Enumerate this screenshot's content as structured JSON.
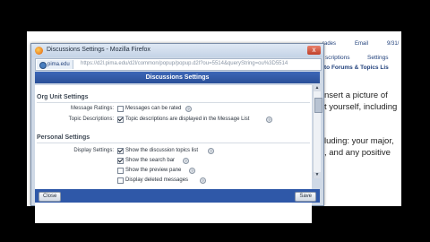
{
  "background_page": {
    "toolbar": {
      "grades": "rades",
      "email": "Email",
      "date": "9/31/"
    },
    "subnav": {
      "descriptions": "scriptions",
      "settings": "Settings"
    },
    "breadcrumb": "to Forums & Topics Lis",
    "lines": [
      "nsert a picture of",
      "t yourself, including",
      "luding: your major,",
      ", and any positive"
    ]
  },
  "window": {
    "title": "Discussions Settings - Mozilla Firefox",
    "close_glyph": "x",
    "site": "pima.edu",
    "url": "https://d2l.pima.edu/d2l/common/popup/popup.d2l?ou=5514&queryString=ou%3D5514"
  },
  "dialog": {
    "header": "Discussions Settings",
    "sections": {
      "org_unit": {
        "heading": "Org Unit Settings",
        "rows": [
          {
            "label": "Message Ratings:",
            "option": "Messages can be rated",
            "checked": false
          },
          {
            "label": "Topic Descriptions:",
            "option": "Topic descriptions are displayed in the Message List",
            "checked": true
          }
        ]
      },
      "personal": {
        "heading": "Personal Settings",
        "label": "Display Settings:",
        "options": [
          {
            "text": "Show the discussion topics list",
            "checked": true
          },
          {
            "text": "Show the search bar",
            "checked": true
          },
          {
            "text": "Show the preview pane",
            "checked": false
          },
          {
            "text": "Display deleted messages",
            "checked": false
          }
        ]
      }
    },
    "footer": {
      "close_label": "Close",
      "save_label": "Save"
    }
  }
}
